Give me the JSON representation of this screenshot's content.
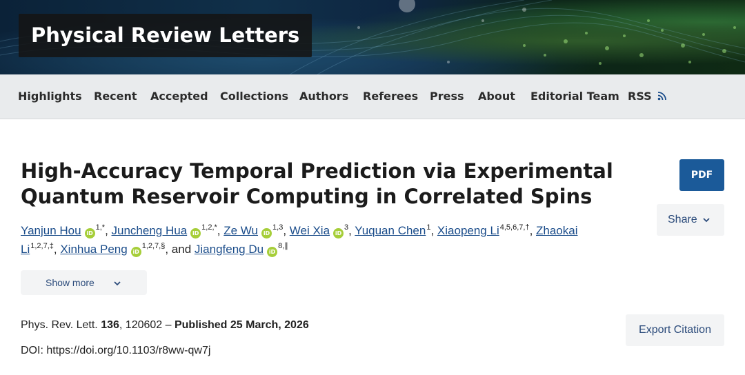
{
  "journal": {
    "title": "Physical Review Letters"
  },
  "nav": {
    "items": [
      "Highlights",
      "Recent",
      "Accepted",
      "Collections",
      "Authors",
      "Referees",
      "Press",
      "About",
      "Editorial Team",
      "RSS"
    ]
  },
  "article": {
    "title_line1": "High-Accuracy Temporal Prediction via Experimental",
    "title_line2": "Quantum Reservoir Computing in Correlated Spins",
    "authors": [
      {
        "name": "Yanjun Hou",
        "orcid": "iD",
        "aff": "1,*"
      },
      {
        "name": "Juncheng Hua",
        "orcid": "iD",
        "aff": "1,2,*"
      },
      {
        "name": "Ze Wu",
        "orcid": "iD",
        "aff": "1,3"
      },
      {
        "name": "Wei Xia",
        "orcid": "iD",
        "aff": "3"
      },
      {
        "name": "Yuquan Chen",
        "aff": "1"
      },
      {
        "name": "Xiaopeng Li",
        "aff": "4,5,6,7,†"
      },
      {
        "name_part1": "Zhaokai",
        "name_part2": "Li",
        "aff": "1,2,7,‡"
      },
      {
        "name": "Xinhua Peng",
        "orcid": "iD",
        "aff": "1,2,7,§"
      },
      {
        "name": "Jiangfeng Du",
        "orcid": "iD",
        "aff": "8,∥"
      }
    ],
    "sep_comma": ", ",
    "sep_and": ", and ",
    "show_more": "Show more",
    "citation": {
      "journal": "Phys. Rev. Lett.",
      "volume": "136",
      "article_number": ", 120602 – ",
      "published": "Published 25 March, 2026"
    },
    "doi": "DOI: https://doi.org/10.1103/r8ww-qw7j"
  },
  "actions": {
    "pdf": "PDF",
    "share": "Share",
    "export": "Export Citation"
  },
  "icons": {
    "chevron": "chevron-down-icon",
    "rss": "rss-icon",
    "orcid": "orcid-icon"
  },
  "colors": {
    "link": "#1a4c8a",
    "pdf_button": "#1b5a99",
    "nav_bg": "#e9ebed",
    "orcid": "#a6ce39"
  }
}
